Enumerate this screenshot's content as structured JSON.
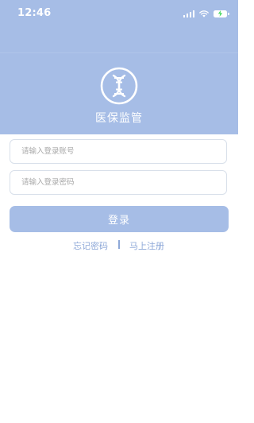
{
  "status_bar": {
    "time": "12:46",
    "icons": [
      "signal-icon",
      "wifi-icon",
      "battery-charging-icon"
    ]
  },
  "app": {
    "title": "医保监管",
    "logo_icon": "dna-icon"
  },
  "login_form": {
    "account_placeholder": "请输入登录账号",
    "password_placeholder": "请输入登录密码",
    "login_button": "登录"
  },
  "links": {
    "forgot_password": "忘记密码",
    "register": "马上注册"
  },
  "colors": {
    "primary": "#a6bde6",
    "link": "#8ea8d8",
    "battery_charging": "#4cd964"
  }
}
